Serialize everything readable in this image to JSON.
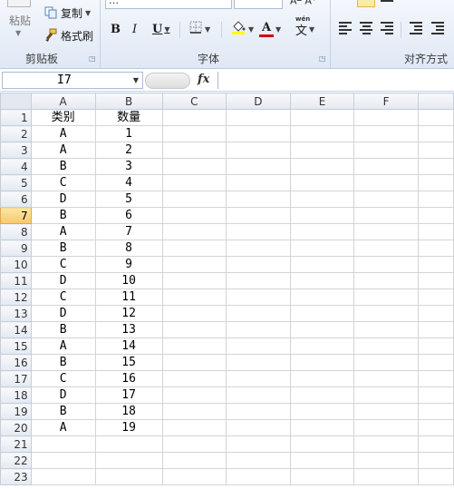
{
  "ribbon": {
    "clipboard": {
      "paste_label": "粘贴",
      "copy_label": "复制",
      "format_painter_label": "格式刷",
      "group_label": "剪贴板"
    },
    "font": {
      "font_name_partial": "…",
      "bold_label": "B",
      "italic_label": "I",
      "underline_label": "U",
      "font_color_letter": "A",
      "phonetic_label": "文",
      "group_label": "字体"
    },
    "alignment": {
      "group_label": "对齐方式"
    }
  },
  "formula_bar": {
    "name_box_value": "I7",
    "fx_label": "fx",
    "formula_value": ""
  },
  "sheet": {
    "columns": [
      "A",
      "B",
      "C",
      "D",
      "E",
      "F"
    ],
    "active_row": 7,
    "rows": [
      {
        "n": "1",
        "a": "类别",
        "b": "数量"
      },
      {
        "n": "2",
        "a": "A",
        "b": "1"
      },
      {
        "n": "3",
        "a": "A",
        "b": "2"
      },
      {
        "n": "4",
        "a": "B",
        "b": "3"
      },
      {
        "n": "5",
        "a": "C",
        "b": "4"
      },
      {
        "n": "6",
        "a": "D",
        "b": "5"
      },
      {
        "n": "7",
        "a": "B",
        "b": "6"
      },
      {
        "n": "8",
        "a": "A",
        "b": "7"
      },
      {
        "n": "9",
        "a": "B",
        "b": "8"
      },
      {
        "n": "10",
        "a": "C",
        "b": "9"
      },
      {
        "n": "11",
        "a": "D",
        "b": "10"
      },
      {
        "n": "12",
        "a": "C",
        "b": "11"
      },
      {
        "n": "13",
        "a": "D",
        "b": "12"
      },
      {
        "n": "14",
        "a": "B",
        "b": "13"
      },
      {
        "n": "15",
        "a": "A",
        "b": "14"
      },
      {
        "n": "16",
        "a": "B",
        "b": "15"
      },
      {
        "n": "17",
        "a": "C",
        "b": "16"
      },
      {
        "n": "18",
        "a": "D",
        "b": "17"
      },
      {
        "n": "19",
        "a": "B",
        "b": "18"
      },
      {
        "n": "20",
        "a": "A",
        "b": "19"
      },
      {
        "n": "21",
        "a": "",
        "b": ""
      },
      {
        "n": "22",
        "a": "",
        "b": ""
      },
      {
        "n": "23",
        "a": "",
        "b": ""
      }
    ]
  },
  "colors": {
    "font_color_bar": "#d40000",
    "highlight_bar": "#ffff00",
    "active_header": "#f5c96a"
  }
}
